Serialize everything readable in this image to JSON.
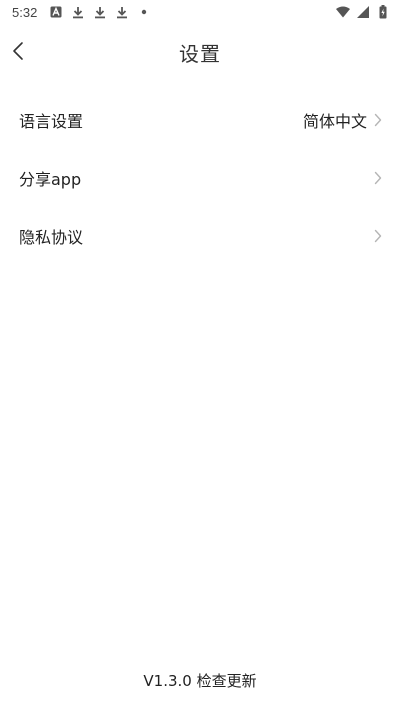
{
  "status_bar": {
    "time": "5:32",
    "left_icons": [
      "a-badge-icon",
      "download-icon",
      "download-icon",
      "download-icon",
      "dot-icon"
    ],
    "right_icons": [
      "wifi-icon",
      "signal-icon",
      "battery-charging-icon"
    ]
  },
  "header": {
    "title": "设置",
    "back_icon": "chevron-left-icon"
  },
  "settings": {
    "items": [
      {
        "label": "语言设置",
        "value": "简体中文"
      },
      {
        "label": "分享app",
        "value": ""
      },
      {
        "label": "隐私协议",
        "value": ""
      }
    ]
  },
  "footer": {
    "version_text": "V1.3.0 检查更新"
  },
  "colors": {
    "background": "#ffffff",
    "text": "#222222",
    "chevron": "#b5b5b5"
  }
}
